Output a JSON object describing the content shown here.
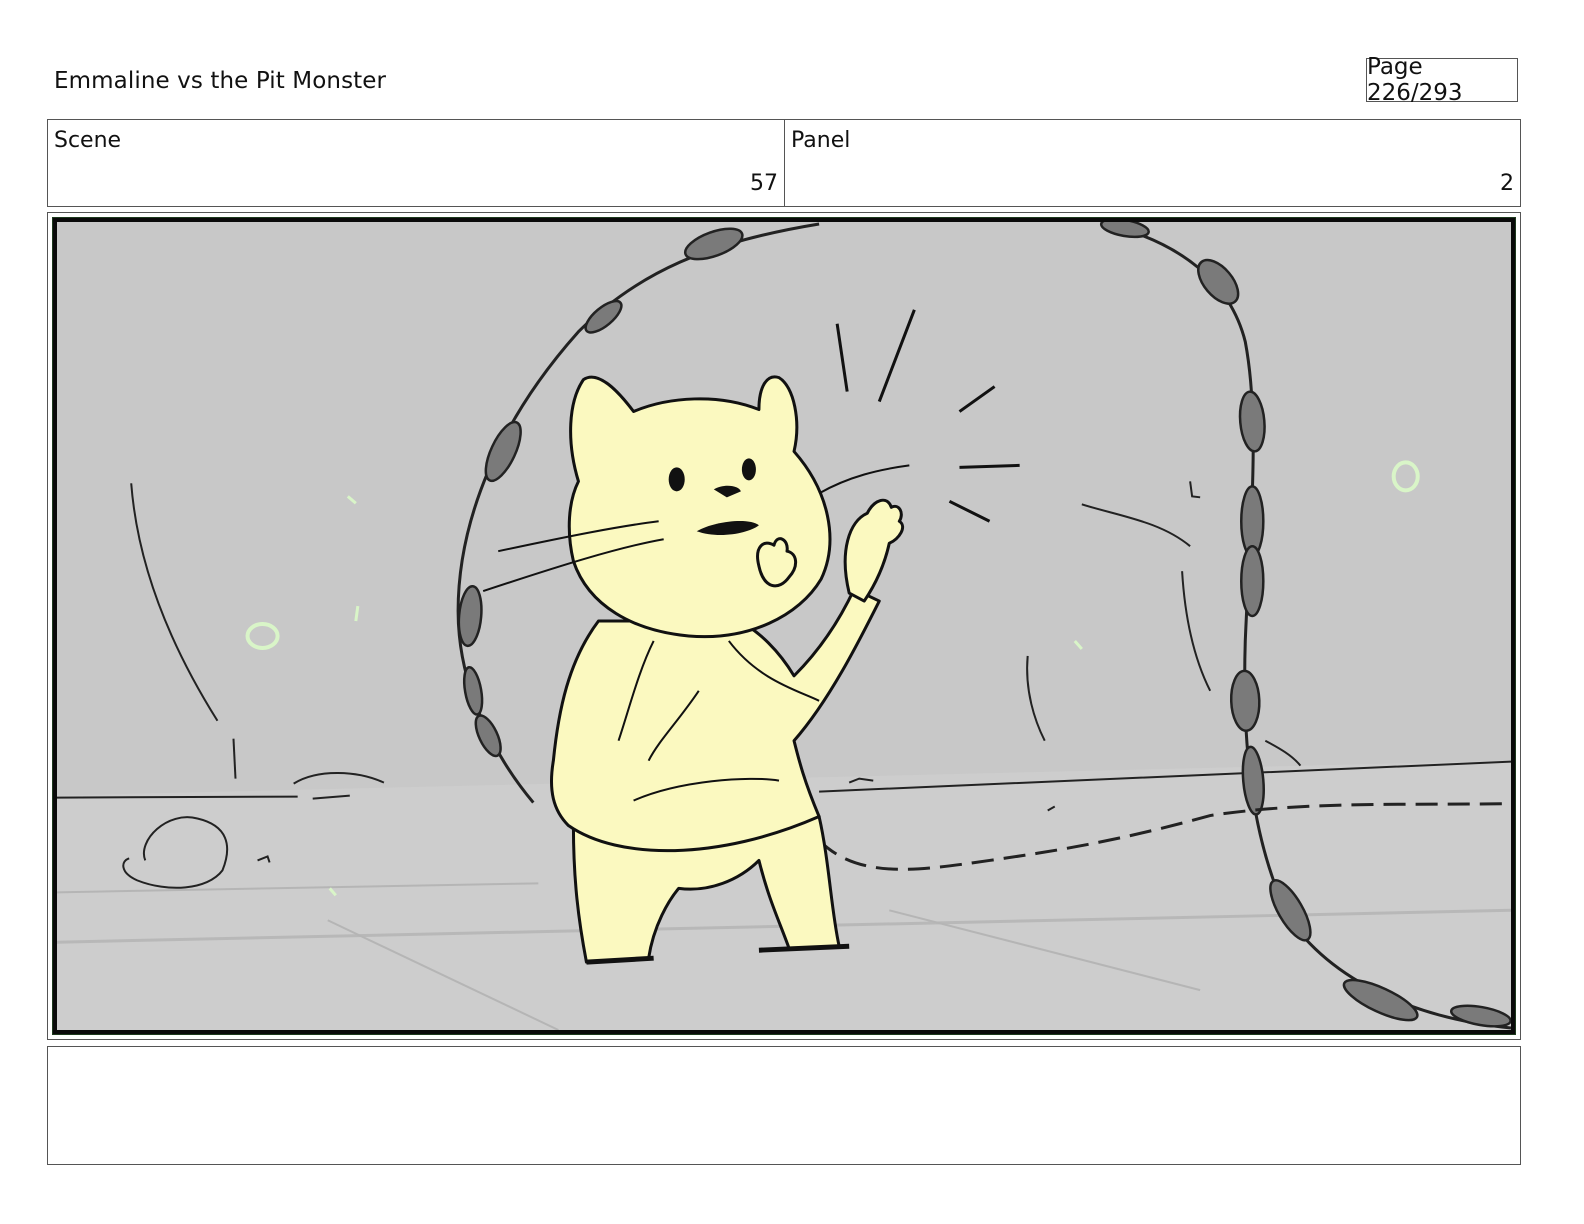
{
  "header": {
    "title": "Emmaline vs the Pit Monster",
    "page_label": "Page 226/293"
  },
  "meta": {
    "scene_label": "Scene",
    "scene_value": "57",
    "panel_label": "Panel",
    "panel_value": "2"
  },
  "panel_image": {
    "description_icon": "storyboard-drawing",
    "colors": {
      "background": "#c8c8c8",
      "character": "#fbf9c0",
      "chain": "#7a7a7a",
      "sparkle": "#d9f5c8",
      "frame": "#0a0a0a"
    }
  },
  "notes": {
    "text": ""
  }
}
